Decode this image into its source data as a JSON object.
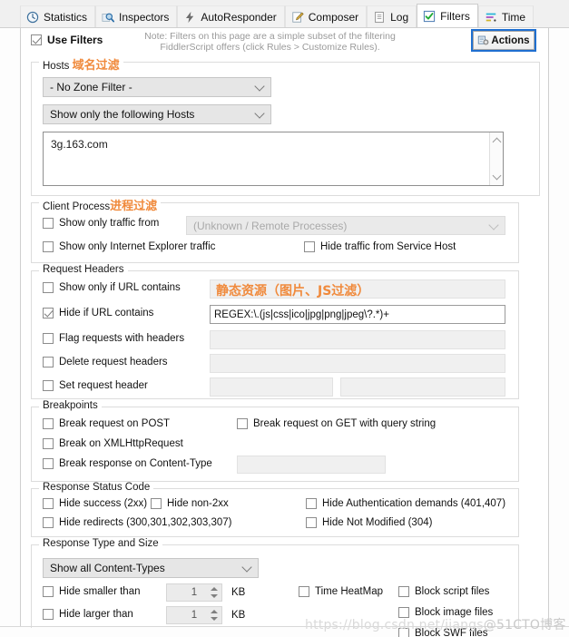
{
  "tabs": [
    {
      "label": "Statistics",
      "icon": "statistics-icon",
      "active": false
    },
    {
      "label": "Inspectors",
      "icon": "inspectors-magnifier-icon",
      "active": false
    },
    {
      "label": "AutoResponder",
      "icon": "lightning-bolt-icon",
      "active": false
    },
    {
      "label": "Composer",
      "icon": "composer-pencil-icon",
      "active": false
    },
    {
      "label": "Log",
      "icon": "log-document-icon",
      "active": false
    },
    {
      "label": "Filters",
      "icon": "filters-checkbox-icon",
      "active": true
    },
    {
      "label": "Time",
      "icon": "timeline-icon",
      "active": false
    }
  ],
  "header": {
    "use_filters_label": "Use Filters",
    "use_filters_checked": true,
    "note_line1": "Note: Filters on this page are a simple subset of the filtering",
    "note_line2": "FiddlerScript offers (click Rules > Customize Rules).",
    "actions_label": "Actions"
  },
  "hosts": {
    "legend": "Hosts",
    "annotation": "域名过滤",
    "zone_filter_value": "- No Zone Filter -",
    "host_mode_value": "Show only the following Hosts",
    "host_list_value": "3g.163.com"
  },
  "client_process": {
    "legend": "Client Process",
    "annotation": "进程过滤",
    "show_only_traffic_from_label": "Show only traffic from",
    "show_only_traffic_from_checked": false,
    "process_combo_value": "(Unknown / Remote Processes)",
    "show_only_ie_label": "Show only Internet Explorer traffic",
    "show_only_ie_checked": false,
    "hide_service_host_label": "Hide traffic from Service Host",
    "hide_service_host_checked": false
  },
  "request_headers": {
    "legend": "Request Headers",
    "annotation": "静态资源（图片、JS过滤）",
    "rows": [
      {
        "label": "Show only if URL contains",
        "checked": false,
        "value": ""
      },
      {
        "label": "Hide if URL contains",
        "checked": true,
        "value": "REGEX:\\.(js|css|ico|jpg|png|jpeg\\?.*)+"
      },
      {
        "label": "Flag requests with headers",
        "checked": false,
        "value": ""
      },
      {
        "label": "Delete request headers",
        "checked": false,
        "value": ""
      },
      {
        "label": "Set request header",
        "checked": false,
        "value": "",
        "value2": ""
      }
    ]
  },
  "breakpoints": {
    "legend": "Breakpoints",
    "break_post_label": "Break request on POST",
    "break_post_checked": false,
    "break_get_query_label": "Break request on GET with query string",
    "break_get_query_checked": false,
    "break_xhr_label": "Break on XMLHttpRequest",
    "break_xhr_checked": false,
    "break_response_ct_label": "Break response on Content-Type",
    "break_response_ct_checked": false,
    "break_response_ct_value": ""
  },
  "response_status": {
    "legend": "Response Status Code",
    "hide_success_label": "Hide success (2xx)",
    "hide_success_checked": false,
    "hide_non2xx_label": "Hide non-2xx",
    "hide_non2xx_checked": false,
    "hide_auth_label": "Hide Authentication demands (401,407)",
    "hide_auth_checked": false,
    "hide_redirects_label": "Hide redirects (300,301,302,303,307)",
    "hide_redirects_checked": false,
    "hide_not_modified_label": "Hide Not Modified (304)",
    "hide_not_modified_checked": false
  },
  "response_type": {
    "legend": "Response Type and Size",
    "content_types_value": "Show all Content-Types",
    "hide_smaller_label": "Hide smaller than",
    "hide_smaller_checked": false,
    "hide_smaller_value": "1",
    "hide_smaller_unit": "KB",
    "hide_larger_label": "Hide larger than",
    "hide_larger_checked": false,
    "hide_larger_value": "1",
    "hide_larger_unit": "KB",
    "time_heatmap_label": "Time HeatMap",
    "time_heatmap_checked": false,
    "block_script_label": "Block script files",
    "block_script_checked": false,
    "block_image_label": "Block image files",
    "block_image_checked": false,
    "block_swf_label": "Block SWF files",
    "block_swf_checked": false
  },
  "watermark": {
    "url": "https://blog.csdn.net/jiangs",
    "suffix": "@51CTO博客"
  },
  "colors": {
    "annotation_orange": "#f08a3c",
    "focus_blue": "#1f6fd0",
    "panel_bg": "#ffffff"
  }
}
